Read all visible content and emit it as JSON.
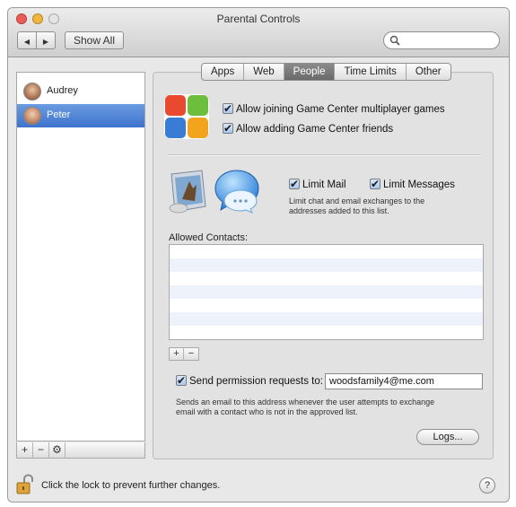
{
  "window": {
    "title": "Parental Controls"
  },
  "toolbar": {
    "back_icon": "◀",
    "forward_icon": "▶",
    "show_all_label": "Show All",
    "search_placeholder": ""
  },
  "users": [
    {
      "name": "Audrey",
      "selected": false
    },
    {
      "name": "Peter",
      "selected": true
    }
  ],
  "user_list_buttons": {
    "add": "+",
    "remove": "−",
    "gear_icon": "⚙"
  },
  "tabs": [
    {
      "label": "Apps",
      "active": false
    },
    {
      "label": "Web",
      "active": false
    },
    {
      "label": "People",
      "active": true
    },
    {
      "label": "Time Limits",
      "active": false
    },
    {
      "label": "Other",
      "active": false
    }
  ],
  "game_center": {
    "allow_multiplayer": {
      "label": "Allow joining Game Center multiplayer games",
      "checked": true
    },
    "allow_friends": {
      "label": "Allow adding Game Center friends",
      "checked": true
    }
  },
  "mail_messages": {
    "limit_mail": {
      "label": "Limit Mail",
      "checked": true
    },
    "limit_messages": {
      "label": "Limit Messages",
      "checked": true
    },
    "description_line1": "Limit chat and email exchanges to the",
    "description_line2": "addresses added to this list."
  },
  "allowed_contacts": {
    "label": "Allowed Contacts:",
    "items": [],
    "add_label": "+",
    "remove_label": "−"
  },
  "permission": {
    "label": "Send permission requests to:",
    "checked": true,
    "email": "woodsfamily4@me.com",
    "note_line1": "Sends an email to this address whenever the user attempts to exchange",
    "note_line2": "email with a contact who is not in the approved list."
  },
  "logs_label": "Logs...",
  "footer": {
    "lock_message": "Click the lock to prevent further changes.",
    "help_label": "?"
  },
  "colors": {
    "selection": "#3d73cc",
    "active_tab": "#6a6a6a",
    "contact_row_alt": "#eef3fb"
  }
}
